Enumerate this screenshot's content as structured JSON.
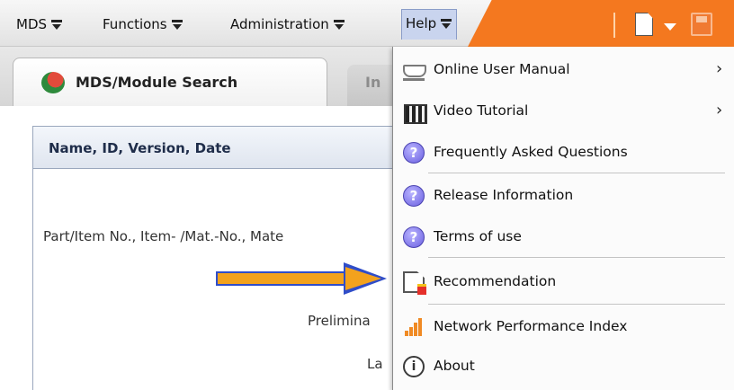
{
  "menubar": {
    "items": [
      {
        "label": "MDS"
      },
      {
        "label": "Functions"
      },
      {
        "label": "Administration"
      },
      {
        "label": "Help"
      }
    ],
    "toolbar_icons": [
      "new-document-icon",
      "dropdown-caret-icon",
      "save-icon"
    ]
  },
  "tabs": {
    "active": "MDS/Module Search",
    "inactive": "In"
  },
  "section": {
    "title": "Name, ID, Version, Date"
  },
  "form": {
    "fields": [
      "Part/Item No., Item- /Mat.-No., Mate",
      "Prelimina",
      "La"
    ]
  },
  "help_menu": {
    "items": [
      {
        "label": "Online User Manual",
        "icon": "book-icon",
        "submenu": true
      },
      {
        "label": "Video Tutorial",
        "icon": "film-clapper-icon",
        "submenu": true
      },
      {
        "label": "Frequently Asked Questions",
        "icon": "question-icon",
        "submenu": false
      },
      {
        "label": "Release Information",
        "icon": "question-icon",
        "submenu": false
      },
      {
        "label": "Terms of use",
        "icon": "question-icon",
        "submenu": false
      },
      {
        "label": "Recommendation",
        "icon": "document-icon",
        "submenu": false
      },
      {
        "label": "Network Performance Index",
        "icon": "signal-bars-icon",
        "submenu": false
      },
      {
        "label": "About",
        "icon": "info-icon",
        "submenu": false
      }
    ],
    "submenu_glyph": "›",
    "question_glyph": "?",
    "info_glyph": "i"
  },
  "colors": {
    "accent_orange": "#f4781f",
    "menu_active": "#c9d4ee",
    "arrow_fill": "#f3a21d",
    "arrow_outline": "#2f4dc9"
  }
}
